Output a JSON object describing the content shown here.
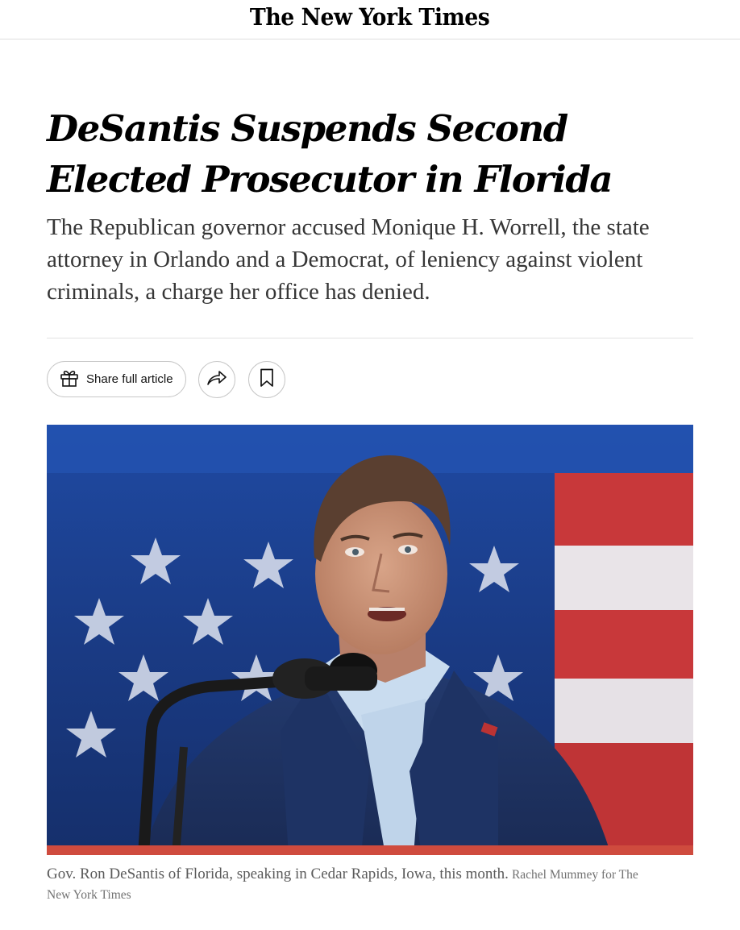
{
  "masthead": {
    "title": "The New York Times"
  },
  "article": {
    "headline": "DeSantis Suspends Second Elected Prosecutor in Florida",
    "summary": "The Republican governor accused Monique H. Worrell, the state attorney in Orlando and a Democrat, of leniency against violent criminals, a charge her office has denied."
  },
  "actions": {
    "share_label": "Share full article",
    "share_icon": "gift-icon",
    "forward_icon": "share-arrow-icon",
    "bookmark_icon": "bookmark-icon"
  },
  "photo": {
    "caption": "Gov. Ron DeSantis of Florida, speaking in Cedar Rapids, Iowa, this month.",
    "credit": "Rachel Mummey for The New York Times"
  },
  "colors": {
    "text": "#121212",
    "summary": "#363636",
    "border": "#c7c7c7",
    "divider": "#e2e2e2",
    "flag_blue": "#1d3f8a",
    "flag_red": "#c8383a"
  }
}
